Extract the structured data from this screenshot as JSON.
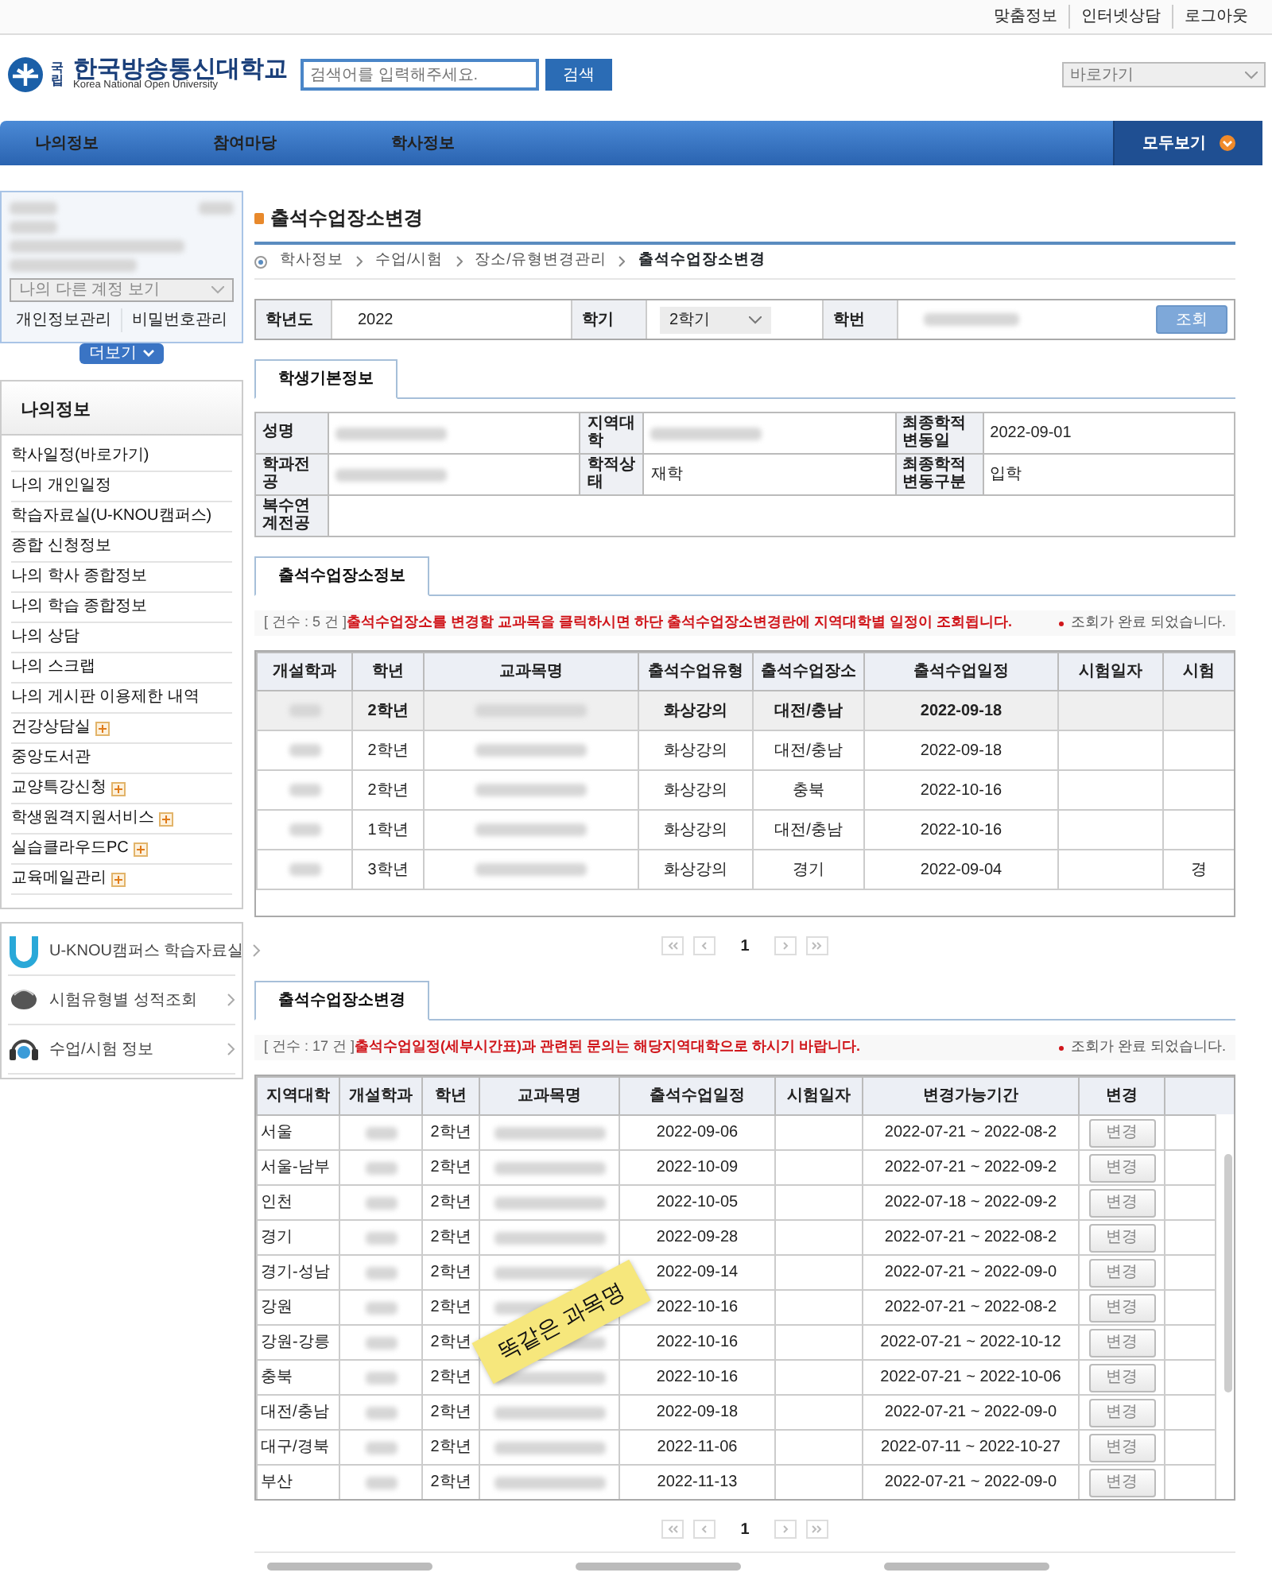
{
  "header": {
    "utility_links": [
      "맞춤정보",
      "인터넷상담",
      "로그아웃"
    ],
    "logo": {
      "badge": "국립",
      "name": "한국방송통신대학교",
      "subtitle": "Korea National Open University"
    },
    "search": {
      "placeholder": "검색어를 입력해주세요.",
      "button": "검색"
    },
    "quick_select": "바로가기"
  },
  "nav": {
    "items": [
      "나의정보",
      "참여마당",
      "학사정보"
    ],
    "all_button": "모두보기"
  },
  "sidebar": {
    "account_select": "나의 다른 계정 보기",
    "account_links": [
      "개인정보관리",
      "비밀번호관리"
    ],
    "more_button": "더보기",
    "menu_title": "나의정보",
    "menu_items": [
      {
        "label": "학사일정(바로가기)",
        "expandable": false
      },
      {
        "label": "나의 개인일정",
        "expandable": false
      },
      {
        "label": "학습자료실(U-KNOU캠퍼스)",
        "expandable": false
      },
      {
        "label": "종합 신청정보",
        "expandable": false
      },
      {
        "label": "나의 학사 종합정보",
        "expandable": false
      },
      {
        "label": "나의 학습 종합정보",
        "expandable": false
      },
      {
        "label": "나의 상담",
        "expandable": false
      },
      {
        "label": "나의 스크랩",
        "expandable": false
      },
      {
        "label": "나의 게시판 이용제한 내역",
        "expandable": false
      },
      {
        "label": "건강상담실",
        "expandable": true
      },
      {
        "label": "중앙도서관",
        "expandable": false
      },
      {
        "label": "교양특강신청",
        "expandable": true
      },
      {
        "label": "학생원격지원서비스",
        "expandable": true
      },
      {
        "label": "실습클라우드PC",
        "expandable": true
      },
      {
        "label": "교육메일관리",
        "expandable": true
      }
    ],
    "quick_links": [
      {
        "label": "U-KNOU캠퍼스 학습자료실",
        "kind": "u"
      },
      {
        "label": "시험유형별 성적조회",
        "kind": "mouse"
      },
      {
        "label": "수업/시험 정보",
        "kind": "headset"
      }
    ]
  },
  "page": {
    "title": "출석수업장소변경",
    "breadcrumb": [
      "학사정보",
      "수업/시험",
      "장소/유형변경관리",
      "출석수업장소변경"
    ],
    "filter": {
      "year_label": "학년도",
      "year": "2022",
      "term_label": "학기",
      "term": "2학기",
      "student_no_label": "학번",
      "button": "조회"
    },
    "student_info": {
      "tab": "학생기본정보",
      "fields": [
        {
          "label": "성명",
          "redacted": true
        },
        {
          "label": "지역대학",
          "redacted": true
        },
        {
          "label": "최종학적변동일",
          "value": "2022-09-01"
        },
        {
          "label": "학과전공",
          "redacted": true
        },
        {
          "label": "학적상태",
          "value": "재학"
        },
        {
          "label": "최종학적변동구분",
          "value": "입학"
        },
        {
          "label": "복수연계전공"
        }
      ]
    },
    "place_info": {
      "tab": "출석수업장소정보",
      "count": "[ 건수 : 5 건 ]",
      "notice": "출석수업장소를 변경할 교과목을 클릭하시면 하단 출석수업장소변경란에 지역대학별 일정이 조회됩니다.",
      "status": "조회가 완료 되었습니다.",
      "columns": [
        {
          "label": "개설학과",
          "kind": "redacted"
        },
        {
          "label": "학년",
          "kind": "text"
        },
        {
          "label": "교과목명",
          "kind": "redacted"
        },
        {
          "label": "출석수업유형",
          "kind": "text"
        },
        {
          "label": "출석수업장소",
          "kind": "text"
        },
        {
          "label": "출석수업일정",
          "kind": "text"
        },
        {
          "label": "시험일자",
          "kind": "text"
        },
        {
          "label": "시험",
          "kind": "text"
        }
      ],
      "rows": [
        {
          "selected": true,
          "cells": [
            null,
            "2학년",
            null,
            "화상강의",
            "대전/충남",
            "2022-09-18",
            null,
            null
          ]
        },
        {
          "selected": false,
          "cells": [
            null,
            "2학년",
            null,
            "화상강의",
            "대전/충남",
            "2022-09-18",
            null,
            null
          ]
        },
        {
          "selected": false,
          "cells": [
            null,
            "2학년",
            null,
            "화상강의",
            "충북",
            "2022-10-16",
            null,
            null
          ]
        },
        {
          "selected": false,
          "cells": [
            null,
            "1학년",
            null,
            "화상강의",
            "대전/충남",
            "2022-10-16",
            null,
            null
          ]
        },
        {
          "selected": false,
          "cells": [
            null,
            "3학년",
            null,
            "화상강의",
            "경기",
            "2022-09-04",
            null,
            "경"
          ]
        }
      ],
      "pager": {
        "page": "1"
      }
    },
    "place_change": {
      "tab": "출석수업장소변경",
      "count": "[ 건수 : 17 건 ]",
      "notice": "출석수업일정(세부시간표)과 관련된 문의는 해당지역대학으로 하시기 바랍니다.",
      "status": "조회가 완료 되었습니다.",
      "columns": [
        {
          "label": "지역대학",
          "kind": "text"
        },
        {
          "label": "개설학과",
          "kind": "redacted"
        },
        {
          "label": "학년",
          "kind": "text"
        },
        {
          "label": "교과목명",
          "kind": "redacted"
        },
        {
          "label": "출석수업일정",
          "kind": "text"
        },
        {
          "label": "시험일자",
          "kind": "text"
        },
        {
          "label": "변경가능기간",
          "kind": "text"
        },
        {
          "label": "변경",
          "kind": "button"
        }
      ],
      "rows": [
        {
          "cells": [
            "서울",
            null,
            "2학년",
            null,
            "2022-09-06",
            null,
            "2022-07-21 ~ 2022-08-2",
            "변경"
          ]
        },
        {
          "cells": [
            "서울-남부",
            null,
            "2학년",
            null,
            "2022-10-09",
            null,
            "2022-07-21 ~ 2022-09-2",
            "변경"
          ]
        },
        {
          "cells": [
            "인천",
            null,
            "2학년",
            null,
            "2022-10-05",
            null,
            "2022-07-18 ~ 2022-09-2",
            "변경"
          ]
        },
        {
          "cells": [
            "경기",
            null,
            "2학년",
            null,
            "2022-09-28",
            null,
            "2022-07-21 ~ 2022-08-2",
            "변경"
          ]
        },
        {
          "cells": [
            "경기-성남",
            null,
            "2학년",
            null,
            "2022-09-14",
            null,
            "2022-07-21 ~ 2022-09-0",
            "변경"
          ]
        },
        {
          "cells": [
            "강원",
            null,
            "2학년",
            null,
            "2022-10-16",
            null,
            "2022-07-21 ~ 2022-08-2",
            "변경"
          ]
        },
        {
          "cells": [
            "강원-강릉",
            null,
            "2학년",
            null,
            "2022-10-16",
            null,
            "2022-07-21 ~ 2022-10-12",
            "변경"
          ]
        },
        {
          "cells": [
            "충북",
            null,
            "2학년",
            null,
            "2022-10-16",
            null,
            "2022-07-21 ~ 2022-10-06",
            "변경"
          ]
        },
        {
          "cells": [
            "대전/충남",
            null,
            "2학년",
            null,
            "2022-09-18",
            null,
            "2022-07-21 ~ 2022-09-0",
            "변경"
          ]
        },
        {
          "cells": [
            "대구/경북",
            null,
            "2학년",
            null,
            "2022-11-06",
            null,
            "2022-07-11 ~ 2022-10-27",
            "변경"
          ]
        },
        {
          "cells": [
            "부산",
            null,
            "2학년",
            null,
            "2022-11-13",
            null,
            "2022-07-21 ~ 2022-09-0",
            "변경"
          ]
        }
      ],
      "sticky_note": {
        "text": "똑같은 과목명"
      },
      "pager": {
        "page": "1"
      }
    }
  }
}
